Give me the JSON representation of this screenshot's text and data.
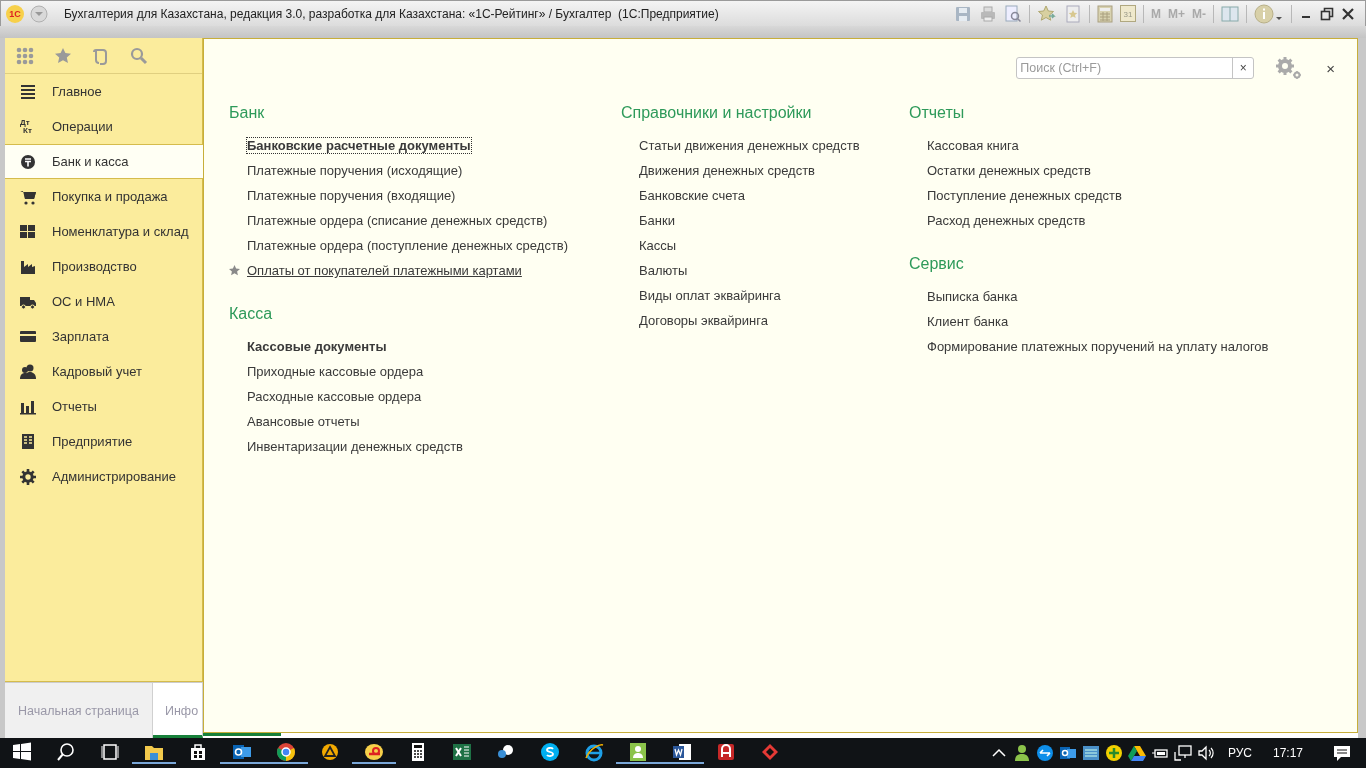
{
  "window": {
    "logo": "1С",
    "title": "Бухгалтерия для Казахстана, редакция 3.0, разработка для Казахстана: «1С-Рейтинг» / Бухгалтер  (1С:Предприятие)",
    "calendar_day": "31",
    "memory_buttons": [
      "M",
      "M+",
      "M-"
    ]
  },
  "sidebar": {
    "items": [
      {
        "label": "Главное",
        "selected": false
      },
      {
        "label": "Операции",
        "selected": false,
        "icon_text": [
          "Дт",
          "Кт"
        ]
      },
      {
        "label": "Банк и касса",
        "selected": true
      },
      {
        "label": "Покупка и продажа",
        "selected": false
      },
      {
        "label": "Номенклатура и склад",
        "selected": false
      },
      {
        "label": "Производство",
        "selected": false
      },
      {
        "label": "ОС и НМА",
        "selected": false
      },
      {
        "label": "Зарплата",
        "selected": false
      },
      {
        "label": "Кадровый учет",
        "selected": false
      },
      {
        "label": "Отчеты",
        "selected": false
      },
      {
        "label": "Предприятие",
        "selected": false
      },
      {
        "label": "Администрирование",
        "selected": false
      }
    ]
  },
  "search": {
    "placeholder": "Поиск (Ctrl+F)",
    "clear": "×"
  },
  "close": "×",
  "columns": [
    {
      "sections": [
        {
          "title": "Банк",
          "items": [
            {
              "text": "Банковские расчетные документы",
              "bold": true,
              "focused": true,
              "starred": false
            },
            {
              "text": "Платежные поручения (исходящие)",
              "bold": false,
              "focused": false,
              "starred": false
            },
            {
              "text": "Платежные поручения (входящие)",
              "bold": false,
              "focused": false,
              "starred": false
            },
            {
              "text": "Платежные ордера (списание денежных средств)",
              "bold": false,
              "focused": false,
              "starred": false
            },
            {
              "text": "Платежные ордера (поступление денежных средств)",
              "bold": false,
              "focused": false,
              "starred": false
            },
            {
              "text": "Оплаты от покупателей платежными картами",
              "bold": false,
              "focused": false,
              "starred": true
            }
          ]
        },
        {
          "title": "Касса",
          "items": [
            {
              "text": "Кассовые документы",
              "bold": true,
              "focused": false,
              "starred": false
            },
            {
              "text": "Приходные кассовые ордера",
              "bold": false,
              "focused": false,
              "starred": false
            },
            {
              "text": "Расходные кассовые ордера",
              "bold": false,
              "focused": false,
              "starred": false
            },
            {
              "text": "Авансовые отчеты",
              "bold": false,
              "focused": false,
              "starred": false
            },
            {
              "text": "Инвентаризации денежных средств",
              "bold": false,
              "focused": false,
              "starred": false
            }
          ]
        }
      ]
    },
    {
      "sections": [
        {
          "title": "Справочники и настройки",
          "items": [
            {
              "text": "Статьи движения денежных средств",
              "bold": false,
              "focused": false,
              "starred": false
            },
            {
              "text": "Движения денежных средств",
              "bold": false,
              "focused": false,
              "starred": false
            },
            {
              "text": "Банковские счета",
              "bold": false,
              "focused": false,
              "starred": false
            },
            {
              "text": "Банки",
              "bold": false,
              "focused": false,
              "starred": false
            },
            {
              "text": "Кассы",
              "bold": false,
              "focused": false,
              "starred": false
            },
            {
              "text": "Валюты",
              "bold": false,
              "focused": false,
              "starred": false
            },
            {
              "text": "Виды оплат эквайринга",
              "bold": false,
              "focused": false,
              "starred": false
            },
            {
              "text": "Договоры эквайринга",
              "bold": false,
              "focused": false,
              "starred": false
            }
          ]
        }
      ]
    },
    {
      "sections": [
        {
          "title": "Отчеты",
          "items": [
            {
              "text": "Кассовая книга",
              "bold": false,
              "focused": false,
              "starred": false
            },
            {
              "text": "Остатки денежных средств",
              "bold": false,
              "focused": false,
              "starred": false
            },
            {
              "text": "Поступление денежных средств",
              "bold": false,
              "focused": false,
              "starred": false
            },
            {
              "text": "Расход денежных средств",
              "bold": false,
              "focused": false,
              "starred": false
            }
          ]
        },
        {
          "title": "Сервис",
          "items": [
            {
              "text": "Выписка банка",
              "bold": false,
              "focused": false,
              "starred": false
            },
            {
              "text": "Клиент банка",
              "bold": false,
              "focused": false,
              "starred": false
            },
            {
              "text": "Формирование платежных поручений на уплату налогов",
              "bold": false,
              "focused": false,
              "starred": false
            }
          ]
        }
      ]
    }
  ],
  "open_tabs": [
    {
      "label": "Начальная страница",
      "selected": false
    },
    {
      "label": "Инфо",
      "selected": true
    }
  ],
  "taskbar": {
    "language": "РУС",
    "time": "17:17"
  }
}
